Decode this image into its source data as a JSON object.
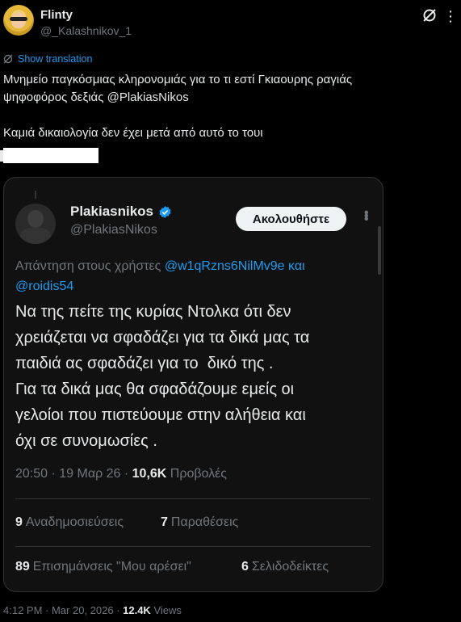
{
  "author": {
    "name": "Flinty",
    "handle": "@_Kalashnikov_1"
  },
  "show_translation": "Show translation",
  "tweet_text": "Μνημείο παγκόσμιας κληρονομιάς για το τι εστί Γκιαουρης ραγιάς\nψηφοφόρος δεξιάς @PlakiasNikos\n\nΚαμιά δικαιολογία δεν έχει μετά από αυτό το τουι",
  "quoted": {
    "name": "Plakiasnikos",
    "handle": "@PlakiasNikos",
    "follow_label": "Ακολουθήστε",
    "reply_prefix": "Απάντηση στους χρήστες ",
    "reply_mentions": "@w1qRzns6NilMv9e και",
    "reply_mentions_2": "@roidis54",
    "text": "Να της πείτε της κυρίας Ντολκα ότι δεν\nχρειάζεται να σφαδάζει για τα δικά μας τα\nπαιδιά ας σφαδάζει για το  δικό της .\nΓια τα δικά μας θα σφαδάζουμε εμείς οι\nγελοίοι που πιστεύουμε στην αλήθεια και\nόχι σε συνομωσίες .",
    "time": "20:50 · 19 Μαρ 26 · ",
    "views_count": "10,6K",
    "views_label": " Προβολές",
    "reposts_count": "9",
    "reposts_label": "Αναδημοσιεύσεις",
    "quotes_count": "7",
    "quotes_label": "Παραθέσεις",
    "likes_count": "89",
    "likes_label": "Επισημάνσεις \"Μου αρέσει\"",
    "bookmarks_count": "6",
    "bookmarks_label": "Σελιδοδείκτες"
  },
  "footer": {
    "timestamp": "4:12 PM · Mar 20, 2026 · ",
    "views_count": "12.4K",
    "views_label": " Views"
  },
  "colors": {
    "accent": "#1d9bf0",
    "background": "#000000",
    "card_background": "#111111",
    "muted": "#71767b"
  },
  "icons": [
    "avatar",
    "grok-icon",
    "more-icon",
    "translate-icon",
    "verified-badge-icon"
  ]
}
